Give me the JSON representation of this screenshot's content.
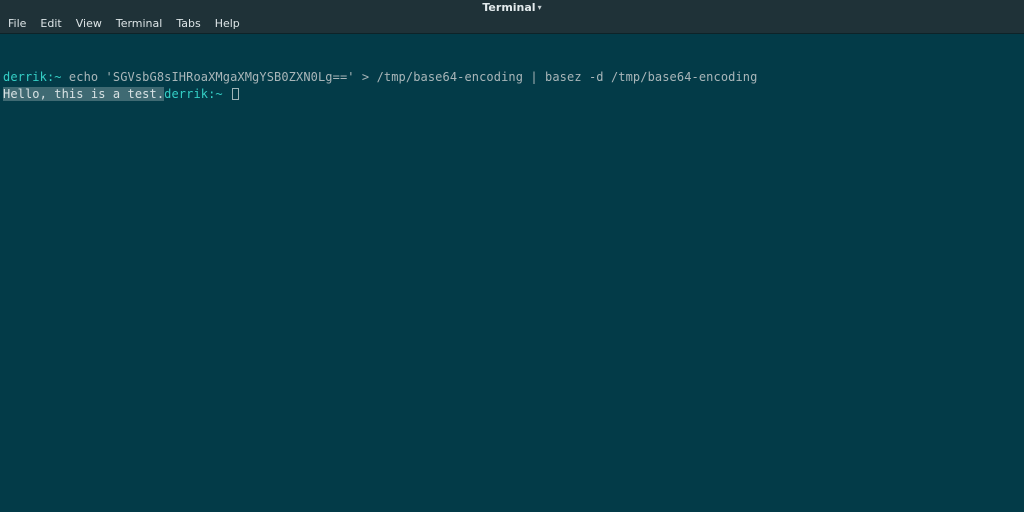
{
  "titlebar": {
    "title": "Terminal"
  },
  "menubar": {
    "items": [
      "File",
      "Edit",
      "View",
      "Terminal",
      "Tabs",
      "Help"
    ]
  },
  "term": {
    "prompt": "derrik:~",
    "command": " echo 'SGVsbG8sIHRoaXMgaXMgYSB0ZXN0Lg==' > /tmp/base64-encoding | basez -d /tmp/base64-encoding",
    "output": "Hello, this is a test.",
    "prompt2": "derrik:~"
  }
}
